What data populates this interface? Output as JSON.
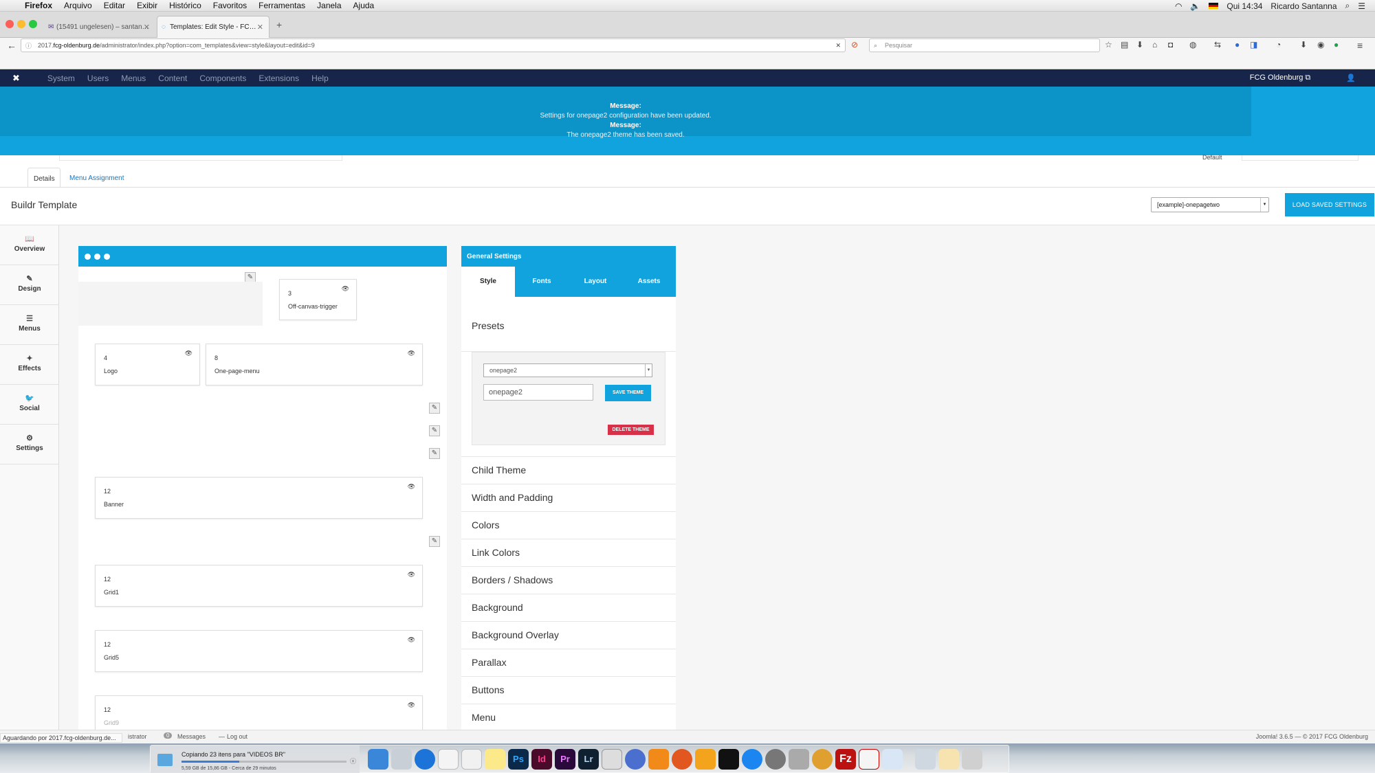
{
  "menubar": {
    "app": "Firefox",
    "items": [
      "Arquivo",
      "Editar",
      "Exibir",
      "Histórico",
      "Favoritos",
      "Ferramentas",
      "Janela",
      "Ajuda"
    ],
    "clock": "Qui 14:34",
    "user": "Ricardo Santanna"
  },
  "browser": {
    "tabs": [
      {
        "title": "(15491 ungelesen) – santan…"
      },
      {
        "title": "Templates: Edit Style - FC…"
      }
    ],
    "url_prefix": "2017.",
    "url_domain": "fcg-oldenburg.de",
    "url_path": "/administrator/index.php?option=com_templates&view=style&layout=edit&id=9",
    "search_placeholder": "Pesquisar"
  },
  "joomla_nav": {
    "items": [
      "System",
      "Users",
      "Menus",
      "Content",
      "Components",
      "Extensions",
      "Help"
    ],
    "site_link": "FCG Oldenburg ⧉"
  },
  "messages": [
    {
      "heading": "Message:",
      "text": "Settings for onepage2 configuration have been updated."
    },
    {
      "heading": "Message:",
      "text": "The onepage2 theme has been saved."
    }
  ],
  "default_label": "Default",
  "subtabs": [
    "Details",
    "Menu Assignment"
  ],
  "buildr": {
    "title": "Buildr Template",
    "preset_select": "[example]-onepagetwo",
    "load_button": "LOAD SAVED SETTINGS"
  },
  "sidebar": [
    {
      "icon": "book-icon",
      "glyph": "📖",
      "label": "Overview"
    },
    {
      "icon": "brush-icon",
      "glyph": "✎",
      "label": "Design"
    },
    {
      "icon": "menu-icon",
      "glyph": "☰",
      "label": "Menus"
    },
    {
      "icon": "effects-icon",
      "glyph": "✦",
      "label": "Effects"
    },
    {
      "icon": "twitter-icon",
      "glyph": "🐦",
      "label": "Social"
    },
    {
      "icon": "gear-icon",
      "glyph": "⚙",
      "label": "Settings"
    }
  ],
  "modules": [
    {
      "num": "3",
      "name": "Off-canvas-trigger"
    },
    {
      "num": "4",
      "name": "Logo"
    },
    {
      "num": "8",
      "name": "One-page-menu"
    },
    {
      "num": "12",
      "name": "Banner"
    },
    {
      "num": "12",
      "name": "Grid1"
    },
    {
      "num": "12",
      "name": "Grid5"
    },
    {
      "num": "12",
      "name": "Grid9"
    }
  ],
  "general_settings": {
    "title": "General Settings",
    "tabs": [
      "Style",
      "Fonts",
      "Layout",
      "Assets"
    ],
    "presets_title": "Presets",
    "preset_select": "onepage2",
    "preset_input": "onepage2",
    "save_button": "SAVE THEME",
    "delete_button": "DELETE THEME",
    "sections": [
      "Child Theme",
      "Width and Padding",
      "Colors",
      "Link Colors",
      "Borders / Shadows",
      "Background",
      "Background Overlay",
      "Parallax",
      "Buttons",
      "Menu"
    ]
  },
  "footer": {
    "status_text": "Aguardando por 2017.fcg-oldenburg.de...",
    "admin_text": "istrator",
    "messages_count": "0",
    "messages_label": "Messages",
    "logout_label": "Log out",
    "version": "Joomla! 3.6.5  —  © 2017 FCG Oldenburg"
  },
  "dock": {
    "copy_title": "Copiando 23 itens para \"VIDEOS BR\"",
    "copy_progress": "5,59 GB de 15,86 GB - Cerca de 29 minutos",
    "copy_fraction": 0.35
  }
}
